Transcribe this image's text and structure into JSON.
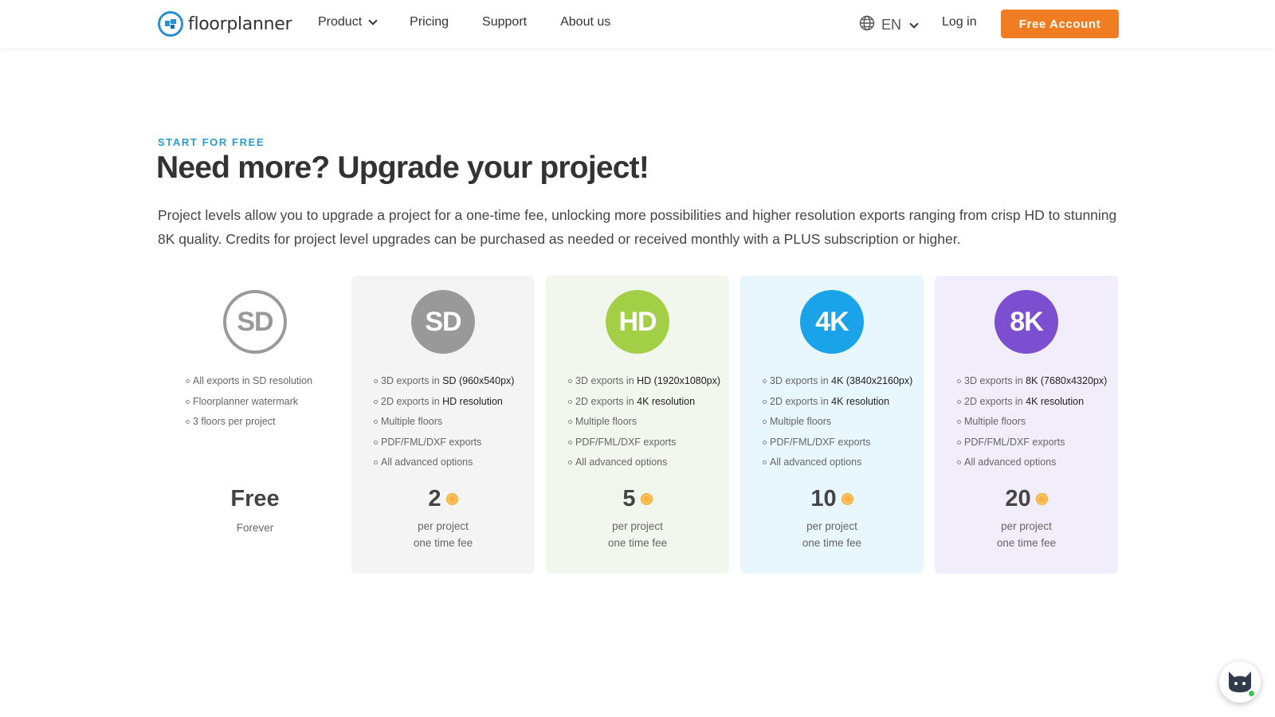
{
  "header": {
    "logo_text": "floorplanner",
    "nav": [
      {
        "label": "Product",
        "has_dropdown": true
      },
      {
        "label": "Pricing",
        "has_dropdown": false
      },
      {
        "label": "Support",
        "has_dropdown": false
      },
      {
        "label": "About us",
        "has_dropdown": false
      }
    ],
    "language": "EN",
    "login_label": "Log in",
    "cta_label": "Free Account"
  },
  "hero": {
    "eyebrow": "START FOR FREE",
    "title": "Need more? Upgrade your project!",
    "description": "Project levels allow you to upgrade a project for a one-time fee, unlocking more possibilities and higher resolution exports ranging from crisp HD to stunning 8K quality. Credits for project level upgrades can be purchased as needed or received monthly with a PLUS subscription or higher."
  },
  "tiers": [
    {
      "badge": "SD",
      "features": [
        {
          "text": "All exports in SD resolution",
          "strong": ""
        },
        {
          "text": "Floorplanner watermark",
          "strong": ""
        },
        {
          "text": "3 floors per project",
          "strong": ""
        }
      ],
      "price": "Free",
      "sub1": "Forever",
      "sub2": ""
    },
    {
      "badge": "SD",
      "features": [
        {
          "text": "3D exports in ",
          "strong": "SD (960x540px)"
        },
        {
          "text": "2D exports in ",
          "strong": "HD resolution"
        },
        {
          "text": "Multiple floors",
          "strong": ""
        },
        {
          "text": "PDF/FML/DXF exports",
          "strong": ""
        },
        {
          "text": "All advanced options",
          "strong": ""
        }
      ],
      "price": "2",
      "sub1": "per project",
      "sub2": "one time fee"
    },
    {
      "badge": "HD",
      "features": [
        {
          "text": "3D exports in ",
          "strong": "HD (1920x1080px)"
        },
        {
          "text": "2D exports in ",
          "strong": "4K resolution"
        },
        {
          "text": "Multiple floors",
          "strong": ""
        },
        {
          "text": "PDF/FML/DXF exports",
          "strong": ""
        },
        {
          "text": "All advanced options",
          "strong": ""
        }
      ],
      "price": "5",
      "sub1": "per project",
      "sub2": "one time fee"
    },
    {
      "badge": "4K",
      "features": [
        {
          "text": "3D exports in ",
          "strong": "4K (3840x2160px)"
        },
        {
          "text": "2D exports in ",
          "strong": "4K resolution"
        },
        {
          "text": "Multiple floors",
          "strong": ""
        },
        {
          "text": "PDF/FML/DXF exports",
          "strong": ""
        },
        {
          "text": "All advanced options",
          "strong": ""
        }
      ],
      "price": "10",
      "sub1": "per project",
      "sub2": "one time fee"
    },
    {
      "badge": "8K",
      "features": [
        {
          "text": "3D exports in ",
          "strong": "8K (7680x4320px)"
        },
        {
          "text": "2D exports in ",
          "strong": "4K resolution"
        },
        {
          "text": "Multiple floors",
          "strong": ""
        },
        {
          "text": "PDF/FML/DXF exports",
          "strong": ""
        },
        {
          "text": "All advanced options",
          "strong": ""
        }
      ],
      "price": "20",
      "sub1": "per project",
      "sub2": "one time fee"
    }
  ],
  "colors": {
    "accent_orange": "#f07d22",
    "eyebrow_blue": "#2b9bd1",
    "sd_badge": "#999999",
    "hd_badge": "#a2cf45",
    "k4_badge": "#1aa3e8",
    "k8_badge": "#7b4fd0"
  }
}
